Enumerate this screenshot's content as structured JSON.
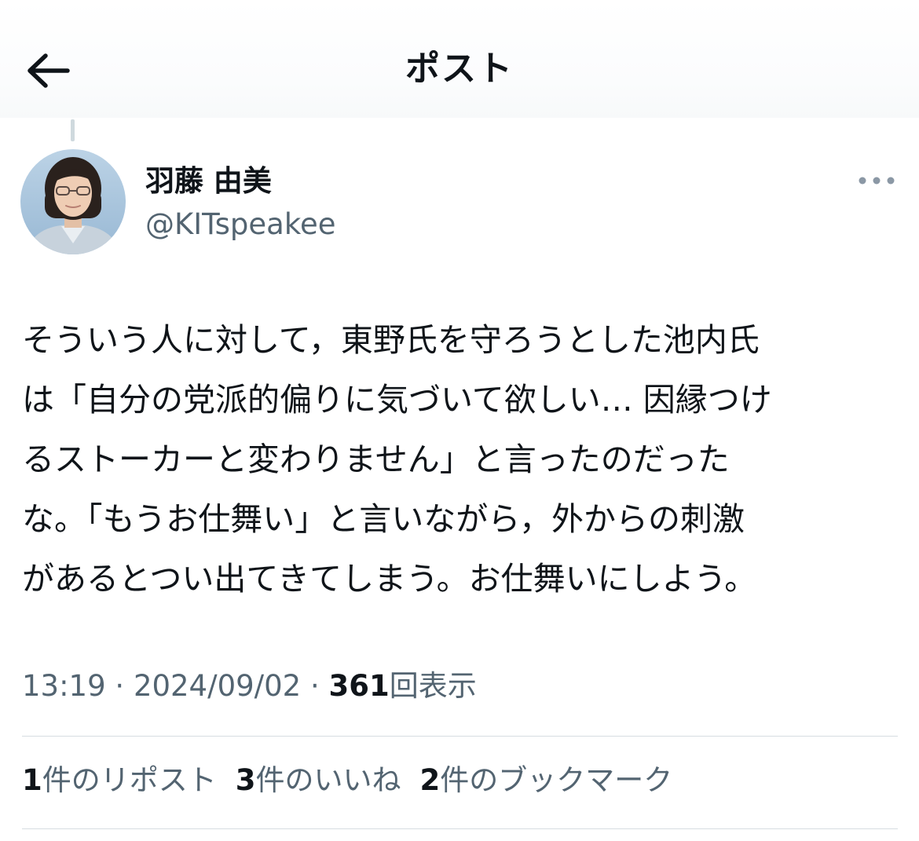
{
  "header": {
    "title": "ポスト",
    "back_icon": "arrow-left-icon"
  },
  "author": {
    "display_name": "羽藤 由美",
    "handle": "@KITspeakee",
    "avatar": "avatar-photo",
    "more_icon": "more-horizontal-icon"
  },
  "post": {
    "text": "そういう人に対して，東野氏を守ろうとした池内氏\nは「自分の党派的偏りに気づいて欲しい… 因縁つけ\nるストーカーと変わりません」と言ったのだった\nな。「もうお仕舞い」と言いながら，外からの刺激\nがあるとつい出てきてしまう。お仕舞いにしよう。",
    "time": "13:19",
    "separator": "·",
    "date": "2024/09/02",
    "views_count": "361",
    "views_label": "回表示"
  },
  "stats": {
    "reposts_count": "1",
    "reposts_label": "件のリポスト",
    "likes_count": "3",
    "likes_label": "件のいいね",
    "bookmarks_count": "2",
    "bookmarks_label": "件のブックマーク"
  },
  "colors": {
    "text_primary": "#0f1419",
    "text_secondary": "#536471",
    "divider": "#d7dde1",
    "thread_line": "#cfd9de"
  }
}
